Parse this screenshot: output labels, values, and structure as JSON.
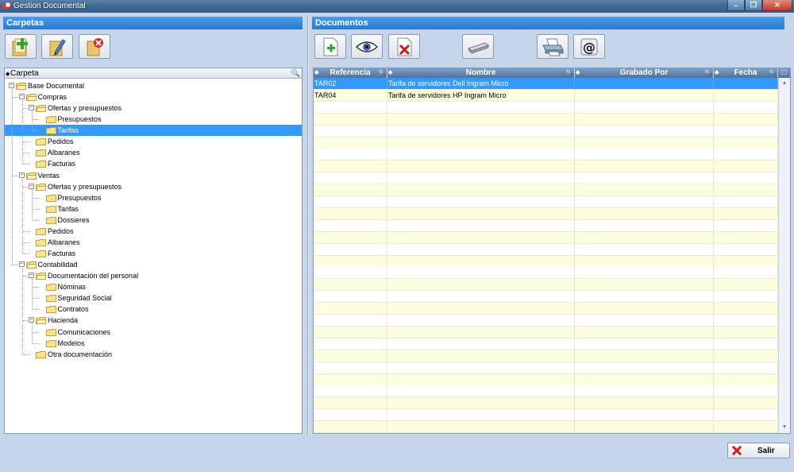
{
  "window": {
    "title": "Gestion Documental"
  },
  "left_panel": {
    "header": "Carpetas",
    "tree_column": "Carpeta",
    "tree": [
      {
        "label": "Base Documental",
        "level": 0,
        "expanded": true
      },
      {
        "label": "Compras",
        "level": 1,
        "expanded": true
      },
      {
        "label": "Ofertas y presupuestos",
        "level": 2,
        "expanded": true
      },
      {
        "label": "Presupuestos",
        "level": 3
      },
      {
        "label": "Tarifas",
        "level": 3,
        "selected": true
      },
      {
        "label": "Pedidos",
        "level": 2
      },
      {
        "label": "Albaranes",
        "level": 2
      },
      {
        "label": "Facturas",
        "level": 2
      },
      {
        "label": "Ventas",
        "level": 1,
        "expanded": true
      },
      {
        "label": "Ofertas y presupuestos",
        "level": 2,
        "expanded": true
      },
      {
        "label": "Presupuestos",
        "level": 3
      },
      {
        "label": "Tarifas",
        "level": 3
      },
      {
        "label": "Dossieres",
        "level": 3
      },
      {
        "label": "Pedidos",
        "level": 2
      },
      {
        "label": "Albaranes",
        "level": 2
      },
      {
        "label": "Facturas",
        "level": 2
      },
      {
        "label": "Contabilidad",
        "level": 1,
        "expanded": true
      },
      {
        "label": "Documentación del personal",
        "level": 2,
        "expanded": true
      },
      {
        "label": "Nóminas",
        "level": 3
      },
      {
        "label": "Seguridad Social",
        "level": 3
      },
      {
        "label": "Contratos",
        "level": 3
      },
      {
        "label": "Hacienda",
        "level": 2,
        "expanded": true
      },
      {
        "label": "Comunicaciones",
        "level": 3
      },
      {
        "label": "Modelos",
        "level": 3
      },
      {
        "label": "Otra documentación",
        "level": 2
      }
    ]
  },
  "right_panel": {
    "header": "Documentos",
    "columns": [
      "Referencia",
      "Nombre",
      "Grabado Por",
      "Fecha"
    ],
    "rows": [
      [
        "TAR02",
        "Tarifa de servidores Dell Ingram Micro",
        "",
        ""
      ],
      [
        "TAR04",
        "Tarifa de servidores HP Ingram Micro",
        "",
        ""
      ]
    ],
    "empty_rows": 28
  },
  "footer": {
    "exit_label": "Salir"
  },
  "colors": {
    "header_blue": "#2b79d2",
    "selected": "#3399ff",
    "row_alt": "#fdfde0",
    "background": "#c6d5ea"
  }
}
